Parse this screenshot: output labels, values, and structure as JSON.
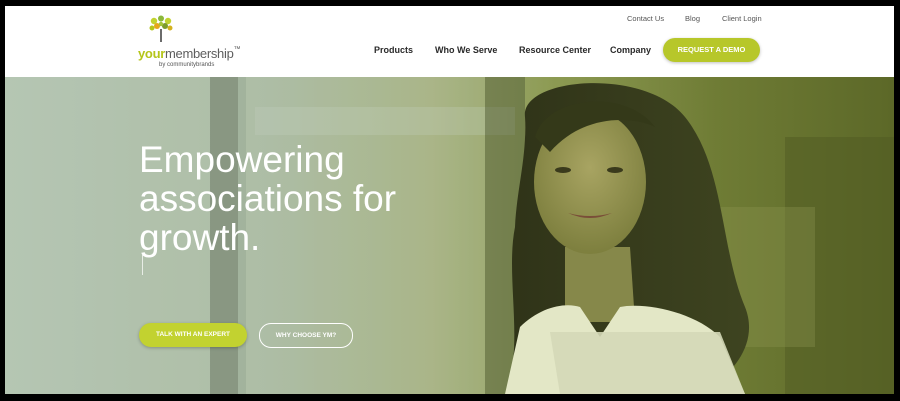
{
  "logo": {
    "word_your": "your",
    "word_membership": "membership",
    "tm": "™",
    "byline": "by communitybrands"
  },
  "utility_nav": {
    "contact": "Contact Us",
    "blog": "Blog",
    "login": "Client Login"
  },
  "main_nav": {
    "products": "Products",
    "who_we_serve": "Who We Serve",
    "resource_center": "Resource Center",
    "company": "Company"
  },
  "demo_button": "REQUEST A DEMO",
  "hero": {
    "headline": [
      "Empowering",
      "associations for",
      "growth."
    ],
    "cta_primary": "TALK WITH AN EXPERT",
    "cta_secondary": "WHY CHOOSE YM?"
  },
  "colors": {
    "brand_green": "#b7c72a",
    "nav_text": "#2a2a2a",
    "frame": "#000000"
  }
}
